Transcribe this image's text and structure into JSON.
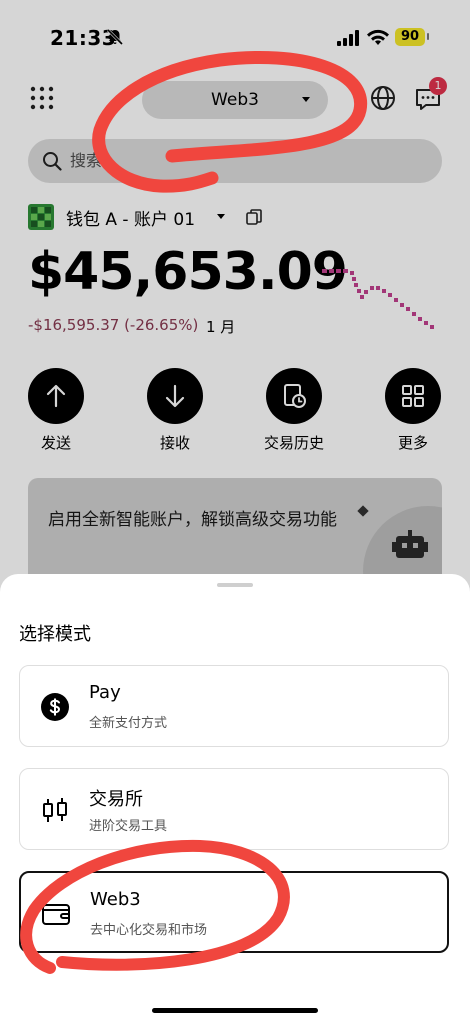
{
  "status_bar": {
    "time": "21:33",
    "battery": "90"
  },
  "header": {
    "mode_label": "Web3",
    "notification_count": "1"
  },
  "search": {
    "placeholder": "搜索"
  },
  "wallet": {
    "name": "钱包 A - 账户 01",
    "balance": "$45,653.09",
    "pnl": "-$16,595.37 (-26.65%)",
    "period": "1 月",
    "pnl_color": "#8a3a52"
  },
  "actions": [
    {
      "label": "发送",
      "icon": "arrow-up-icon"
    },
    {
      "label": "接收",
      "icon": "arrow-down-icon"
    },
    {
      "label": "交易历史",
      "icon": "history-icon"
    },
    {
      "label": "更多",
      "icon": "grid-more-icon"
    }
  ],
  "promo": {
    "text": "启用全新智能账户，解锁高级交易功能"
  },
  "sheet": {
    "title": "选择模式",
    "options": [
      {
        "title": "Pay",
        "subtitle": "全新支付方式",
        "icon": "dollar-coin-icon"
      },
      {
        "title": "交易所",
        "subtitle": "进阶交易工具",
        "icon": "candlestick-icon"
      },
      {
        "title": "Web3",
        "subtitle": "去中心化交易和市场",
        "icon": "wallet-icon",
        "selected": true
      }
    ]
  },
  "colors": {
    "badge": "#e2334e",
    "battery": "#f4e62a",
    "annotation": "#f0463e",
    "sparkline": "#c2418e"
  }
}
